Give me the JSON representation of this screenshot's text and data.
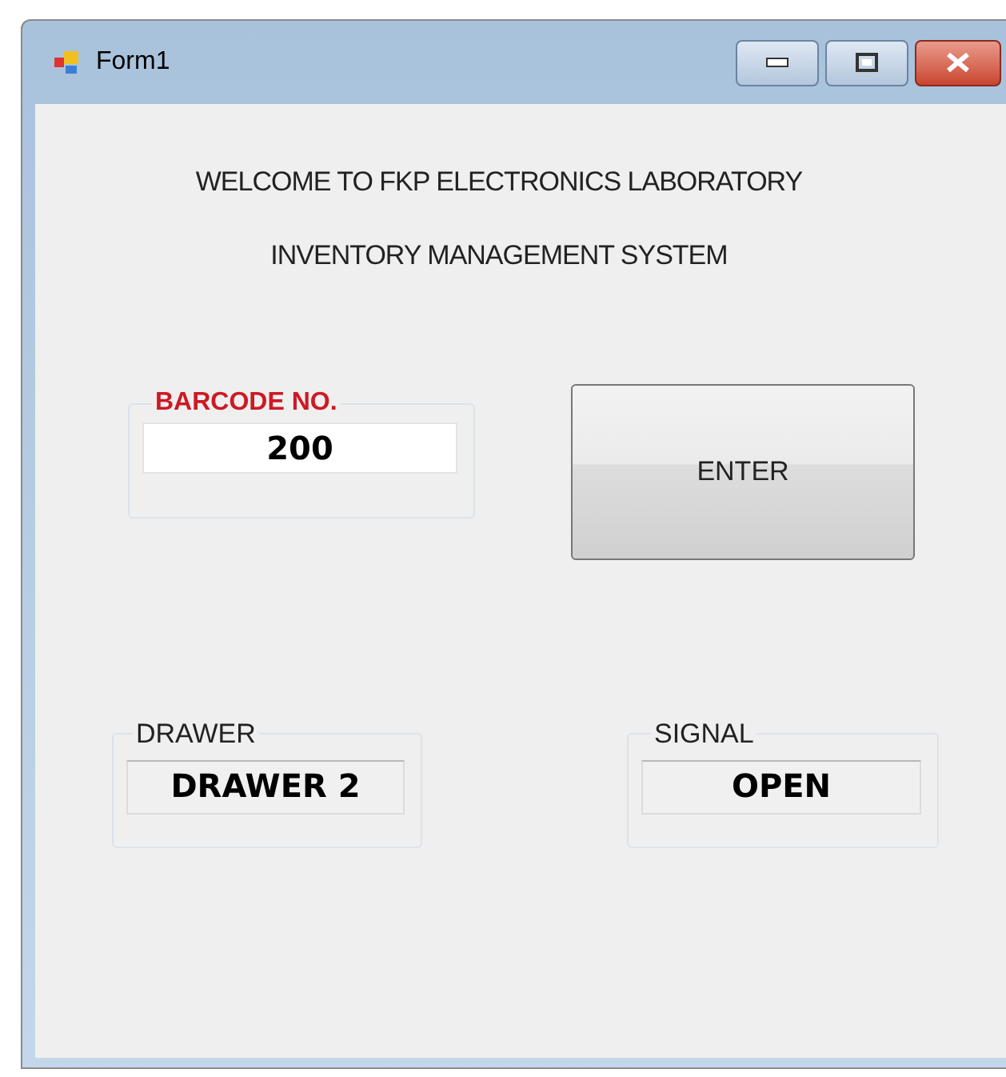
{
  "window": {
    "title": "Form1"
  },
  "heading": [
    "WELCOME TO FKP ELECTRONICS LABORATORY",
    "INVENTORY MANAGEMENT SYSTEM"
  ],
  "barcode": {
    "label": "BARCODE NO.",
    "value": "200"
  },
  "enter_button": {
    "label": "ENTER"
  },
  "drawer": {
    "label": "DRAWER",
    "value": "DRAWER 2"
  },
  "signal": {
    "label": "SIGNAL",
    "value": "OPEN"
  }
}
